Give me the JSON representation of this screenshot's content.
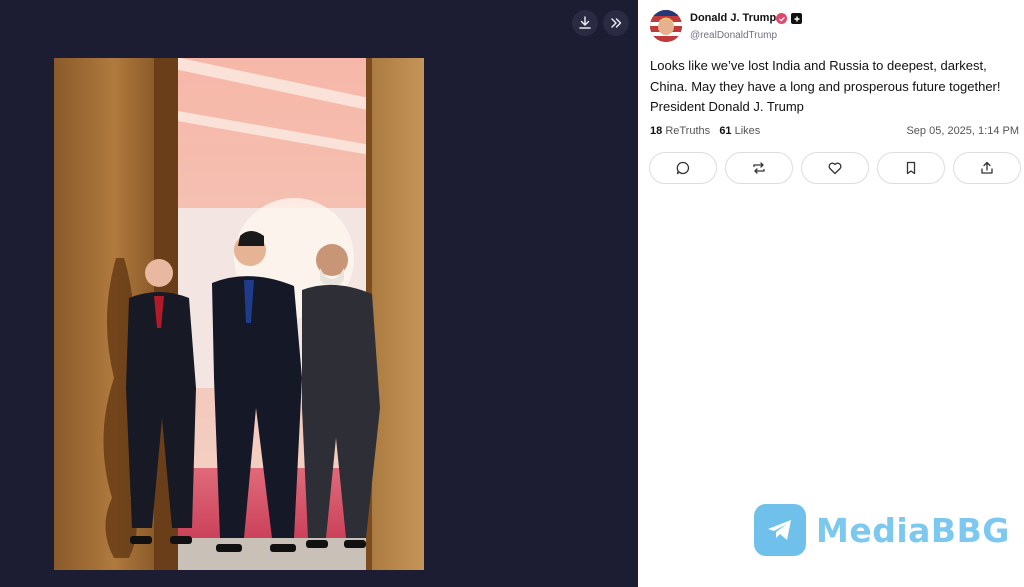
{
  "viewer": {
    "download_icon": "download-icon",
    "expand_icon": "chevrons-right-icon",
    "photo_alt": "Putin, Xi Jinping and Modi walking through a doorway"
  },
  "post": {
    "author_name": "Donald J. Trump",
    "handle": "@realDonaldTrump",
    "verified_icon": "verified-badge-icon",
    "badge_icon": "plus-badge-icon",
    "text": "Looks like we’ve lost India and Russia to deepest, darkest, China. May they have a long and prosperous future together! President Donald J. Trump",
    "retruths_count": "18",
    "retruths_label": "ReTruths",
    "likes_count": "61",
    "likes_label": "Likes",
    "timestamp": "Sep 05, 2025, 1:14 PM"
  },
  "actions": [
    {
      "name": "reply",
      "icon": "comment-icon"
    },
    {
      "name": "retruth",
      "icon": "repost-icon"
    },
    {
      "name": "like",
      "icon": "heart-icon"
    },
    {
      "name": "bookmark",
      "icon": "bookmark-icon"
    },
    {
      "name": "share",
      "icon": "share-icon"
    }
  ],
  "watermark": {
    "text": "MediaBBG"
  },
  "colors": {
    "viewer_bg": "#1c1c32",
    "verified": "#e0476b",
    "watermark": "#7cc8ee"
  }
}
